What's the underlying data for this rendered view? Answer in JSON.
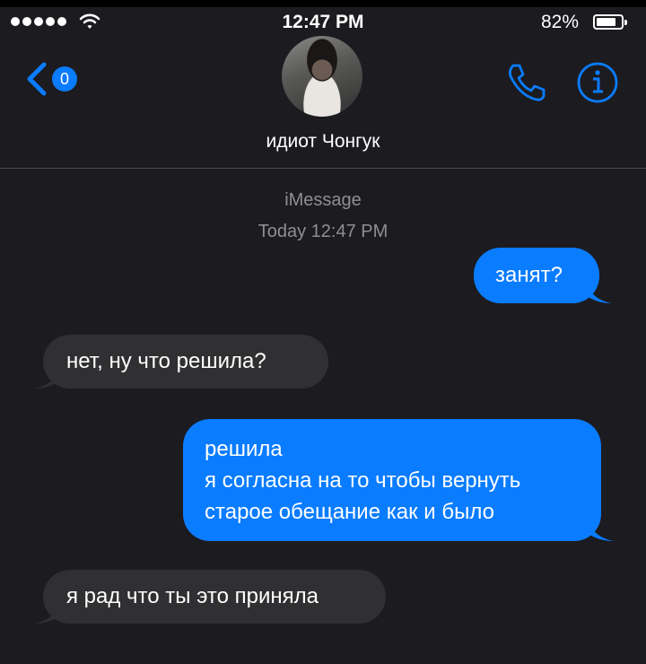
{
  "status_bar": {
    "time": "12:47 PM",
    "battery_percent": "82%",
    "battery_level": 0.82,
    "signal_bars": 5
  },
  "nav": {
    "back_count": "0",
    "contact_name": "идиот Чонгук"
  },
  "conversation": {
    "service": "iMessage",
    "timestamp": "Today 12:47 PM",
    "messages": [
      {
        "from": "me",
        "text": "занят?"
      },
      {
        "from": "them",
        "text": "нет, ну что решила?"
      },
      {
        "from": "me",
        "lines": [
          "решила",
          "я согласна на то чтобы вернуть",
          "старое обещание как и было"
        ]
      },
      {
        "from": "them",
        "text": "я рад что ты это приняла"
      }
    ]
  },
  "colors": {
    "background": "#1c1b1f",
    "outgoing_bubble": "#0a7cff",
    "incoming_bubble": "#303032",
    "accent": "#0a7cff",
    "secondary_text": "#8e8e93"
  }
}
